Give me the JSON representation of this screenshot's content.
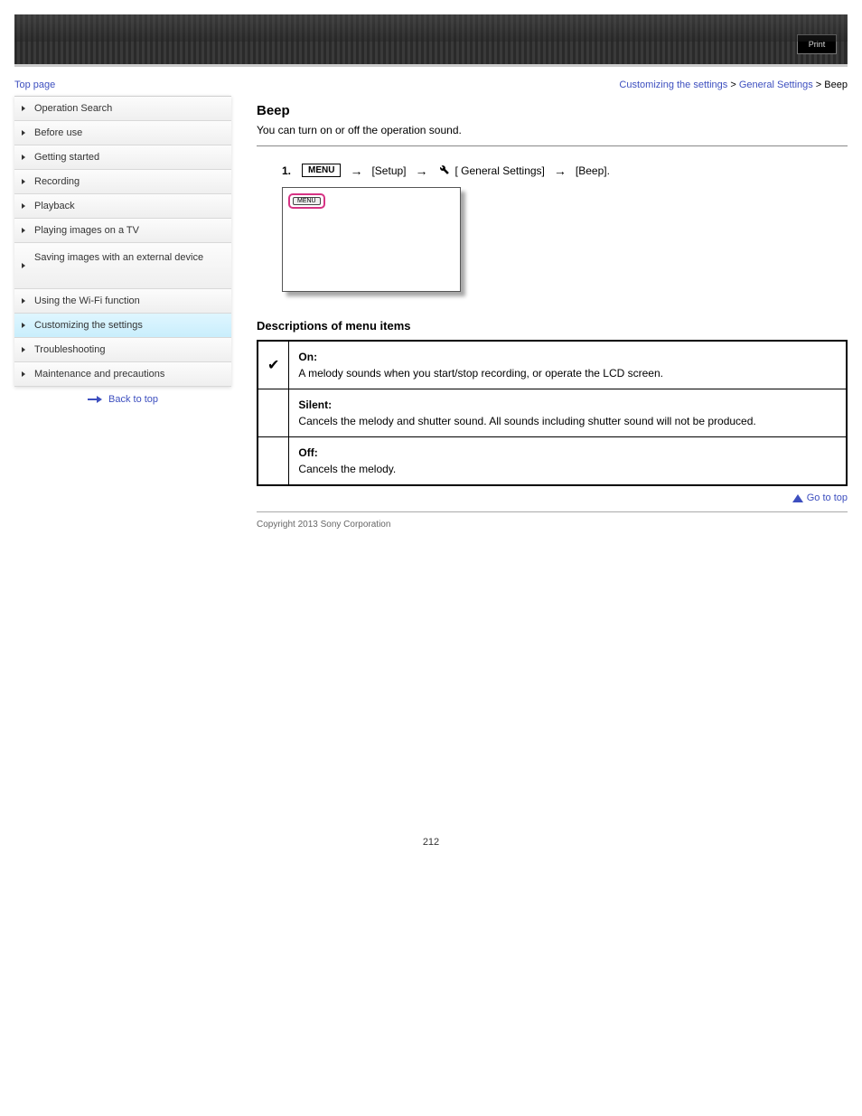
{
  "header": {
    "print_label": "Print",
    "top_link": "Top page",
    "breadcrumb_1": "Customizing the settings",
    "breadcrumb_2": "General Settings",
    "breadcrumb_3": "Beep"
  },
  "sidebar": {
    "items": [
      {
        "label": "Operation Search"
      },
      {
        "label": "Before use"
      },
      {
        "label": "Getting started"
      },
      {
        "label": "Recording"
      },
      {
        "label": "Playback"
      },
      {
        "label": "Playing images on a TV"
      },
      {
        "label": "Saving images with an external device"
      },
      {
        "label": "Using the Wi-Fi function"
      },
      {
        "label": "Customizing the settings"
      },
      {
        "label": "Troubleshooting"
      },
      {
        "label": "Maintenance and precautions"
      }
    ],
    "back_label": "Back to top"
  },
  "main": {
    "title": "Beep",
    "desc": "You can turn on or off the operation sound.",
    "step_num": "1.",
    "step_mid": "[Setup]",
    "step_group": "[     General Settings]",
    "step_last": "[Beep].",
    "menu_text": "MENU",
    "chip_text": "MENU",
    "section_head": "Descriptions of menu items",
    "rows": [
      {
        "icon": "check",
        "title": "On:",
        "body": "A melody sounds when you start/stop recording, or operate the LCD screen."
      },
      {
        "icon": "",
        "title": "Silent:",
        "body": "Cancels the melody and shutter sound. All sounds including shutter sound will not be produced."
      },
      {
        "icon": "",
        "title": "Off:",
        "body": "Cancels the melody."
      }
    ],
    "go_top": "Go to top",
    "copyright": "Copyright 2013 Sony Corporation",
    "page_number": "212"
  }
}
